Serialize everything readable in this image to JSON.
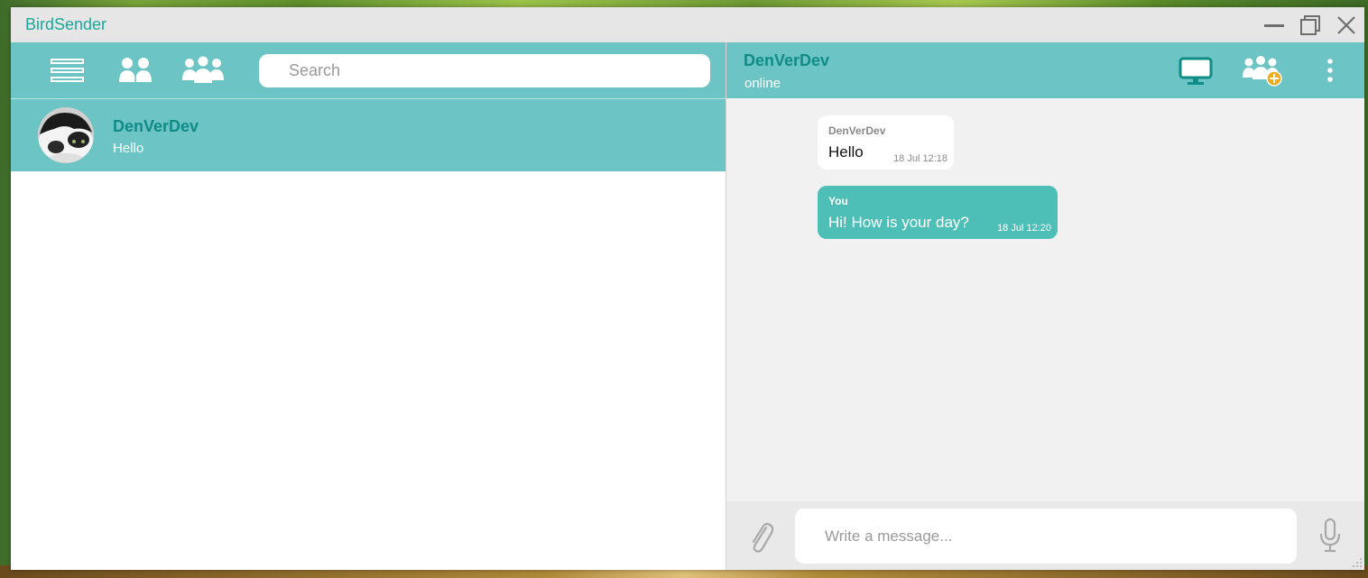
{
  "window": {
    "title": "BirdSender"
  },
  "left_header": {
    "search_placeholder": "Search",
    "icons": [
      "menu-icon",
      "contacts-icon",
      "groups-icon"
    ]
  },
  "chats": [
    {
      "name": "DenVerDev",
      "last_message": "Hello",
      "avatar": "cat-avatar"
    }
  ],
  "conversation": {
    "contact_name": "DenVerDev",
    "status": "online",
    "header_icons": [
      "screen-share-icon",
      "add-group-icon",
      "more-vertical-icon"
    ],
    "messages": [
      {
        "sender": "DenVerDev",
        "text": "Hello",
        "time": "18 Jul 12:18",
        "direction": "incoming"
      },
      {
        "sender": "You",
        "text": "Hi! How is your day?",
        "time": "18 Jul 12:20",
        "direction": "outgoing"
      }
    ]
  },
  "composer": {
    "placeholder": "Write a message..."
  },
  "colors": {
    "accent": "#6cc4c4",
    "accent_dark": "#108c86",
    "outgoing_bubble": "#4dbfb7",
    "title_text": "#1aa89a",
    "add_badge": "#f2a91b"
  }
}
